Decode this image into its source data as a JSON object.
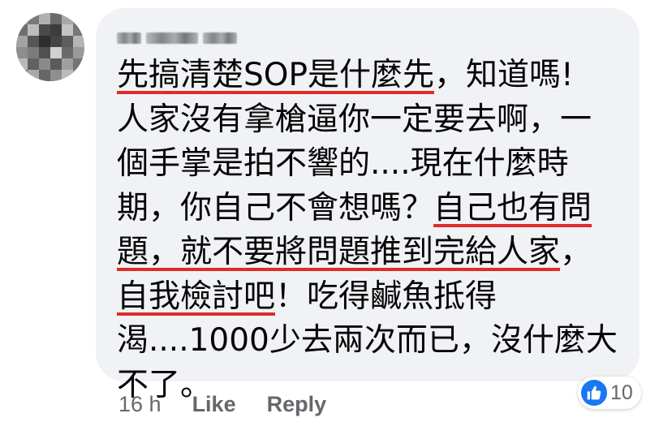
{
  "comment": {
    "author_name": "",
    "lines": [
      {
        "segments": [
          {
            "text": "先搞清楚SOP是什麼先",
            "underline": true
          },
          {
            "text": "，知道嗎!",
            "underline": false
          }
        ]
      },
      {
        "segments": [
          {
            "text": "人家沒有拿槍逼你一定要去啊，一",
            "underline": false
          }
        ]
      },
      {
        "segments": [
          {
            "text": "個手掌是拍不響的....現在什麼時",
            "underline": false
          }
        ]
      },
      {
        "segments": [
          {
            "text": "期，你自己不會想嗎？",
            "underline": false
          },
          {
            "text": "自己也有問",
            "underline": true
          }
        ]
      },
      {
        "segments": [
          {
            "text": "題，就不要將問題推到完給人家",
            "underline": true
          },
          {
            "text": "，",
            "underline": false
          }
        ]
      },
      {
        "segments": [
          {
            "text": "自我檢討吧",
            "underline": true
          },
          {
            "text": "！吃得鹹魚抵得",
            "underline": false
          }
        ]
      },
      {
        "segments": [
          {
            "text": "渴....1000少去兩次而已，沒什麼大",
            "underline": false
          }
        ]
      },
      {
        "segments": [
          {
            "text": "不了。",
            "underline": false
          }
        ]
      }
    ]
  },
  "reactions": {
    "icon": "thumbs-up-icon",
    "count": "10",
    "color": "#1877f2"
  },
  "actions": {
    "timestamp": "16 h",
    "like_label": "Like",
    "reply_label": "Reply"
  },
  "colors": {
    "bubble": "#f0f2f5",
    "text": "#050505",
    "underline": "#e12a2a",
    "meta": "#65676b"
  }
}
